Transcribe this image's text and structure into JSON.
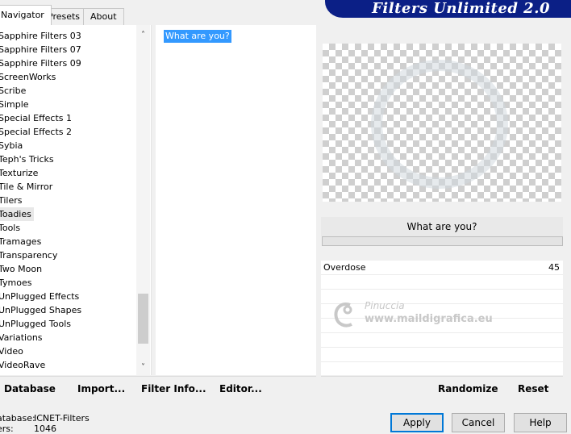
{
  "tabs": [
    "Navigator",
    "Presets",
    "About"
  ],
  "banner_title": "Filters Unlimited 2.0",
  "categories": [
    "Sapphire Filters 03",
    "Sapphire Filters 07",
    "Sapphire Filters 09",
    "ScreenWorks",
    "Scribe",
    "Simple",
    "Special Effects 1",
    "Special Effects 2",
    "Sybia",
    "Teph's Tricks",
    "Texturize",
    "Tile & Mirror",
    "Tilers",
    "Toadies",
    "Tools",
    "Tramages",
    "Transparency",
    "Two Moon",
    "Tymoes",
    "UnPlugged Effects",
    "UnPlugged Shapes",
    "UnPlugged Tools",
    "Variations",
    "Video",
    "VideoRave"
  ],
  "selected_category": "Toadies",
  "selected_filter": "What are you?",
  "filter_name": "What are you?",
  "params": [
    {
      "label": "Overdose",
      "value": "45"
    }
  ],
  "watermark": {
    "title": "Pinuccia",
    "url": "www.maildigrafica.eu"
  },
  "toolbar": {
    "database": "Database",
    "import": "Import...",
    "filter_info": "Filter Info...",
    "editor": "Editor...",
    "randomize": "Randomize",
    "reset": "Reset"
  },
  "footer": {
    "database_label": "atabase:",
    "database_value": "ICNET-Filters",
    "filters_label": "ers:",
    "filters_value": "1046",
    "apply": "Apply",
    "cancel": "Cancel",
    "help": "Help"
  }
}
